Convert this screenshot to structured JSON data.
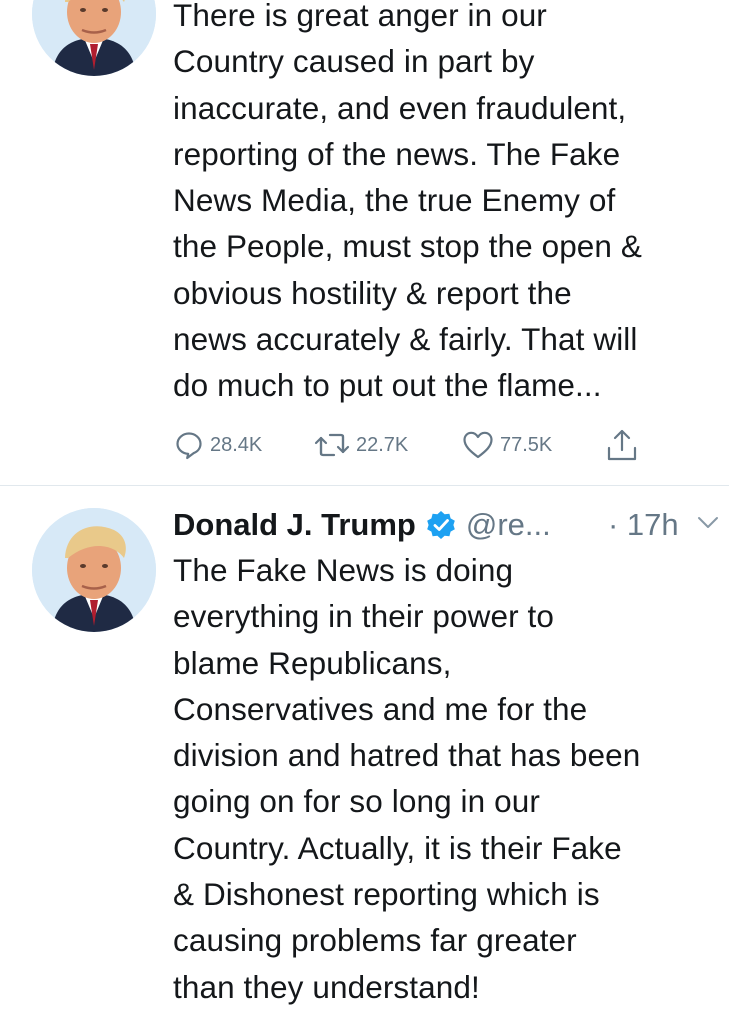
{
  "tweets": [
    {
      "text": "There is great anger in our\nCountry caused in part by\ninaccurate, and even fraudulent,\nreporting of the news. The Fake\nNews Media, the true Enemy of\nthe People, must stop the open &\nobvious hostility & report the\nnews accurately & fairly. That will\ndo much to put out the flame...",
      "replies": "28.4K",
      "retweets": "22.7K",
      "likes": "77.5K"
    },
    {
      "name": "Donald J. Trump",
      "handle": "@re...",
      "time": "· 17h",
      "text": "The Fake News is doing\neverything in their power to\nblame Republicans,\nConservatives and me for the\ndivision and hatred that has been\ngoing on for so long in our\nCountry. Actually, it is their Fake\n& Dishonest reporting which is\ncausing problems far greater\nthan they understand!"
    }
  ],
  "icons": {
    "reply": "reply-icon",
    "retweet": "retweet-icon",
    "like": "heart-icon",
    "share": "share-icon",
    "verified": "verified-badge-icon",
    "caret": "chevron-down-icon"
  },
  "colors": {
    "text": "#14171a",
    "secondary": "#657786",
    "verified": "#1da1f2",
    "divider": "#e1e8ed"
  }
}
